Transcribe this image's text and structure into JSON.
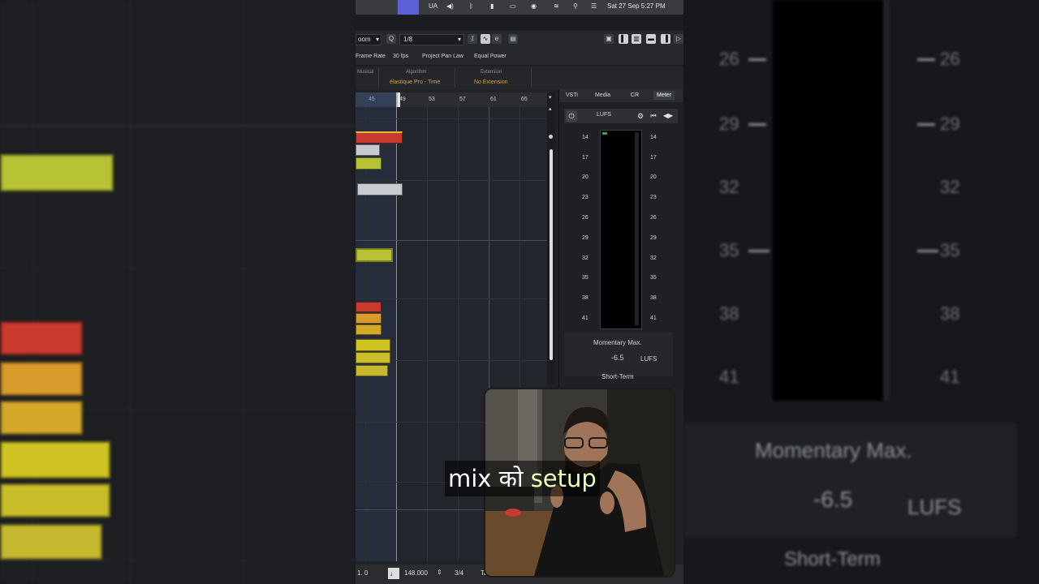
{
  "menubar": {
    "lang": "UA",
    "clock": "Sat 27 Sep  5:27 PM"
  },
  "toolbar": {
    "zoom_label": "oom",
    "quantize_value": "1/8"
  },
  "toolbar2": {
    "frame_rate_label": "Frame Rate",
    "fps": "30 fps",
    "pan_law_label": "Project Pan Law",
    "pan_law_value": "Equal Power"
  },
  "info_line": {
    "col1_label": "Musical",
    "algorithm_label": "Algorithm",
    "algorithm_value": "élastique Pro - Time",
    "extension_label": "Extension",
    "extension_value": "No Extension"
  },
  "ruler": {
    "bars": [
      "45",
      "49",
      "53",
      "57",
      "61",
      "65"
    ]
  },
  "meter_panel": {
    "tabs": [
      "VSTi",
      "Media",
      "CR",
      "Meter"
    ],
    "active_tab": "Meter",
    "unit_label": "LUFS",
    "scale": [
      "14",
      "17",
      "20",
      "23",
      "26",
      "29",
      "32",
      "35",
      "38",
      "41"
    ],
    "momentary_max_label": "Momentary Max.",
    "momentary_max_value": "-6.5",
    "momentary_max_unit": "LUFS",
    "short_term_label": "Short-Term"
  },
  "bottombar": {
    "position": "1.    0",
    "tempo": "148.000",
    "signature": "3/4",
    "tap_label": "Tap"
  },
  "caption": {
    "word1": "mix को",
    "word2": "setup"
  },
  "background_right": {
    "scale": [
      "26",
      "29",
      "32",
      "35",
      "38",
      "41"
    ],
    "momentary_max_label": "Momentary Max.",
    "momentary_max_value": "-6.5",
    "unit": "LUFS",
    "short_term_label": "Short-Term"
  },
  "colors": {
    "clip_red": "#c8392e",
    "clip_yellow": "#c9c21f",
    "clip_orange": "#d89a2a",
    "clip_grey": "#c8ccd0",
    "accent_green": "#2ea84a"
  }
}
